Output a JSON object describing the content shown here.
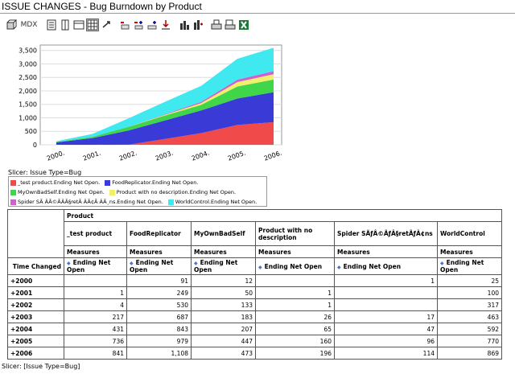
{
  "window": {
    "title": "ISSUE CHANGES - Bug Burndown by Product"
  },
  "toolbar": {
    "mdx_label": "MDX",
    "icons": [
      "cube-icon",
      "mdx-icon",
      "rows-icon",
      "columns-icon",
      "table-icon",
      "grid-icon",
      "swap-icon",
      "drill-icon",
      "expand-icon",
      "collapse-icon",
      "filter-icon",
      "chart-icon",
      "chart-config-icon",
      "print-icon",
      "print-setup-icon",
      "export-excel-icon"
    ]
  },
  "chart_data": {
    "type": "area",
    "categories": [
      "2000.",
      "2001.",
      "2002.",
      "2003.",
      "2004.",
      "2005.",
      "2006."
    ],
    "yticks": [
      "0",
      "500",
      "1,000",
      "1,500",
      "2,000",
      "2,500",
      "3,000",
      "3,500"
    ],
    "ylim": [
      0,
      3700
    ],
    "series": [
      {
        "name": "_test product.Ending Net Open.",
        "color": "#f04a4a",
        "values": [
          0,
          1,
          4,
          217,
          431,
          736,
          841
        ]
      },
      {
        "name": "FoodReplicator.Ending Net Open.",
        "color": "#3a3ad6",
        "values": [
          91,
          249,
          530,
          687,
          843,
          979,
          1108
        ]
      },
      {
        "name": "MyOwnBadSelf.Ending Net Open.",
        "color": "#3fd64a",
        "values": [
          12,
          50,
          133,
          183,
          207,
          447,
          473
        ]
      },
      {
        "name": "Product with no description.Ending Net Open.",
        "color": "#f0f06a",
        "values": [
          0,
          1,
          1,
          26,
          65,
          160,
          196
        ]
      },
      {
        "name": "Spider SÃƒÂ©ÃƒÂ§retÃƒÂ¢ns.Ending Net Open.",
        "color": "#d060d0",
        "values": [
          1,
          0,
          0,
          17,
          47,
          96,
          114
        ]
      },
      {
        "name": "WorldControl.Ending Net Open.",
        "color": "#40e8f0",
        "values": [
          25,
          100,
          317,
          463,
          592,
          770,
          869
        ]
      }
    ]
  },
  "slicer_top": "Slicer: Issue Type=Bug",
  "legend": {
    "rows": [
      [
        {
          "label": "_test product.Ending Net Open.",
          "color": "#f04a4a"
        },
        {
          "label": "FoodReplicator.Ending Net Open.",
          "color": "#3a3ad6"
        }
      ],
      [
        {
          "label": "MyOwnBadSelf.Ending Net Open.",
          "color": "#3fd64a"
        },
        {
          "label": "Product with no description.Ending Net Open.",
          "color": "#f0f06a"
        }
      ],
      [
        {
          "label": "Spider SÃ ÂÃ©ÃÂÃ§retÃ ÂÃ¢Ã ÂÃ¸ns.Ending Net Open.",
          "color": "#d060d0"
        },
        {
          "label": "WorldControl.Ending Net Open.",
          "color": "#40e8f0"
        }
      ]
    ]
  },
  "table": {
    "product_header": "Product",
    "columns": [
      "_test product",
      "FoodReplicator",
      "MyOwnBadSelf",
      "Product with no description",
      "Spider SÃƒÂ©ÃƒÂ§retÃƒÂ¢ns",
      "WorldControl"
    ],
    "measures_label": "Measures",
    "measure_name": "Ending Net Open",
    "time_header": "Time Changed",
    "rows": [
      {
        "label": "+2000",
        "values": [
          "",
          "91",
          "12",
          "",
          "1",
          "25"
        ]
      },
      {
        "label": "+2001",
        "values": [
          "1",
          "249",
          "50",
          "1",
          "",
          "100"
        ]
      },
      {
        "label": "+2002",
        "values": [
          "4",
          "530",
          "133",
          "1",
          "",
          "317"
        ]
      },
      {
        "label": "+2003",
        "values": [
          "217",
          "687",
          "183",
          "26",
          "17",
          "463"
        ]
      },
      {
        "label": "+2004",
        "values": [
          "431",
          "843",
          "207",
          "65",
          "47",
          "592"
        ]
      },
      {
        "label": "+2005",
        "values": [
          "736",
          "979",
          "447",
          "160",
          "96",
          "770"
        ]
      },
      {
        "label": "+2006",
        "values": [
          "841",
          "1,108",
          "473",
          "196",
          "114",
          "869"
        ]
      }
    ]
  },
  "slicer_bottom": "Slicer: [Issue Type=Bug]"
}
